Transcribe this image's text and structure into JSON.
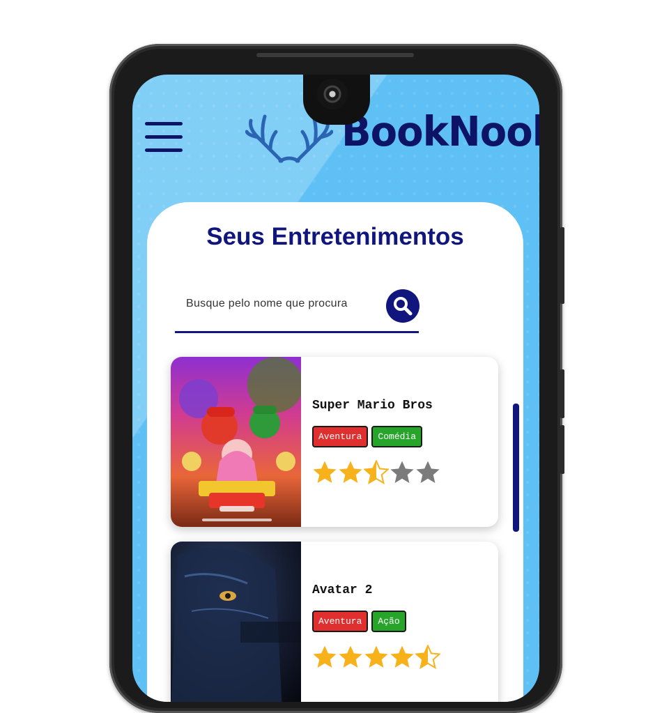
{
  "app": {
    "name": "BookNook",
    "colors": {
      "brand": "#0d1466",
      "background": "#5ec0f4",
      "star_filled": "#f7b21b",
      "star_empty": "#7b7b7b",
      "tag_red": "#e02f2f",
      "tag_green": "#27a52a"
    }
  },
  "header": {
    "menu_icon": "hamburger-menu-icon",
    "logo_icon": "antler-logo-icon",
    "logo_text": "BookNook"
  },
  "main": {
    "title": "Seus Entretenimentos",
    "search": {
      "placeholder": "Busque pelo nome que procura",
      "value": "",
      "icon": "search-icon"
    },
    "items": [
      {
        "title": "Super Mario Bros",
        "tags": [
          "Aventura",
          "Comédia"
        ],
        "rating": 2.5,
        "max_rating": 5
      },
      {
        "title": "Avatar 2",
        "tags": [
          "Aventura",
          "Ação"
        ],
        "rating": 4.5,
        "max_rating": 5
      }
    ]
  }
}
